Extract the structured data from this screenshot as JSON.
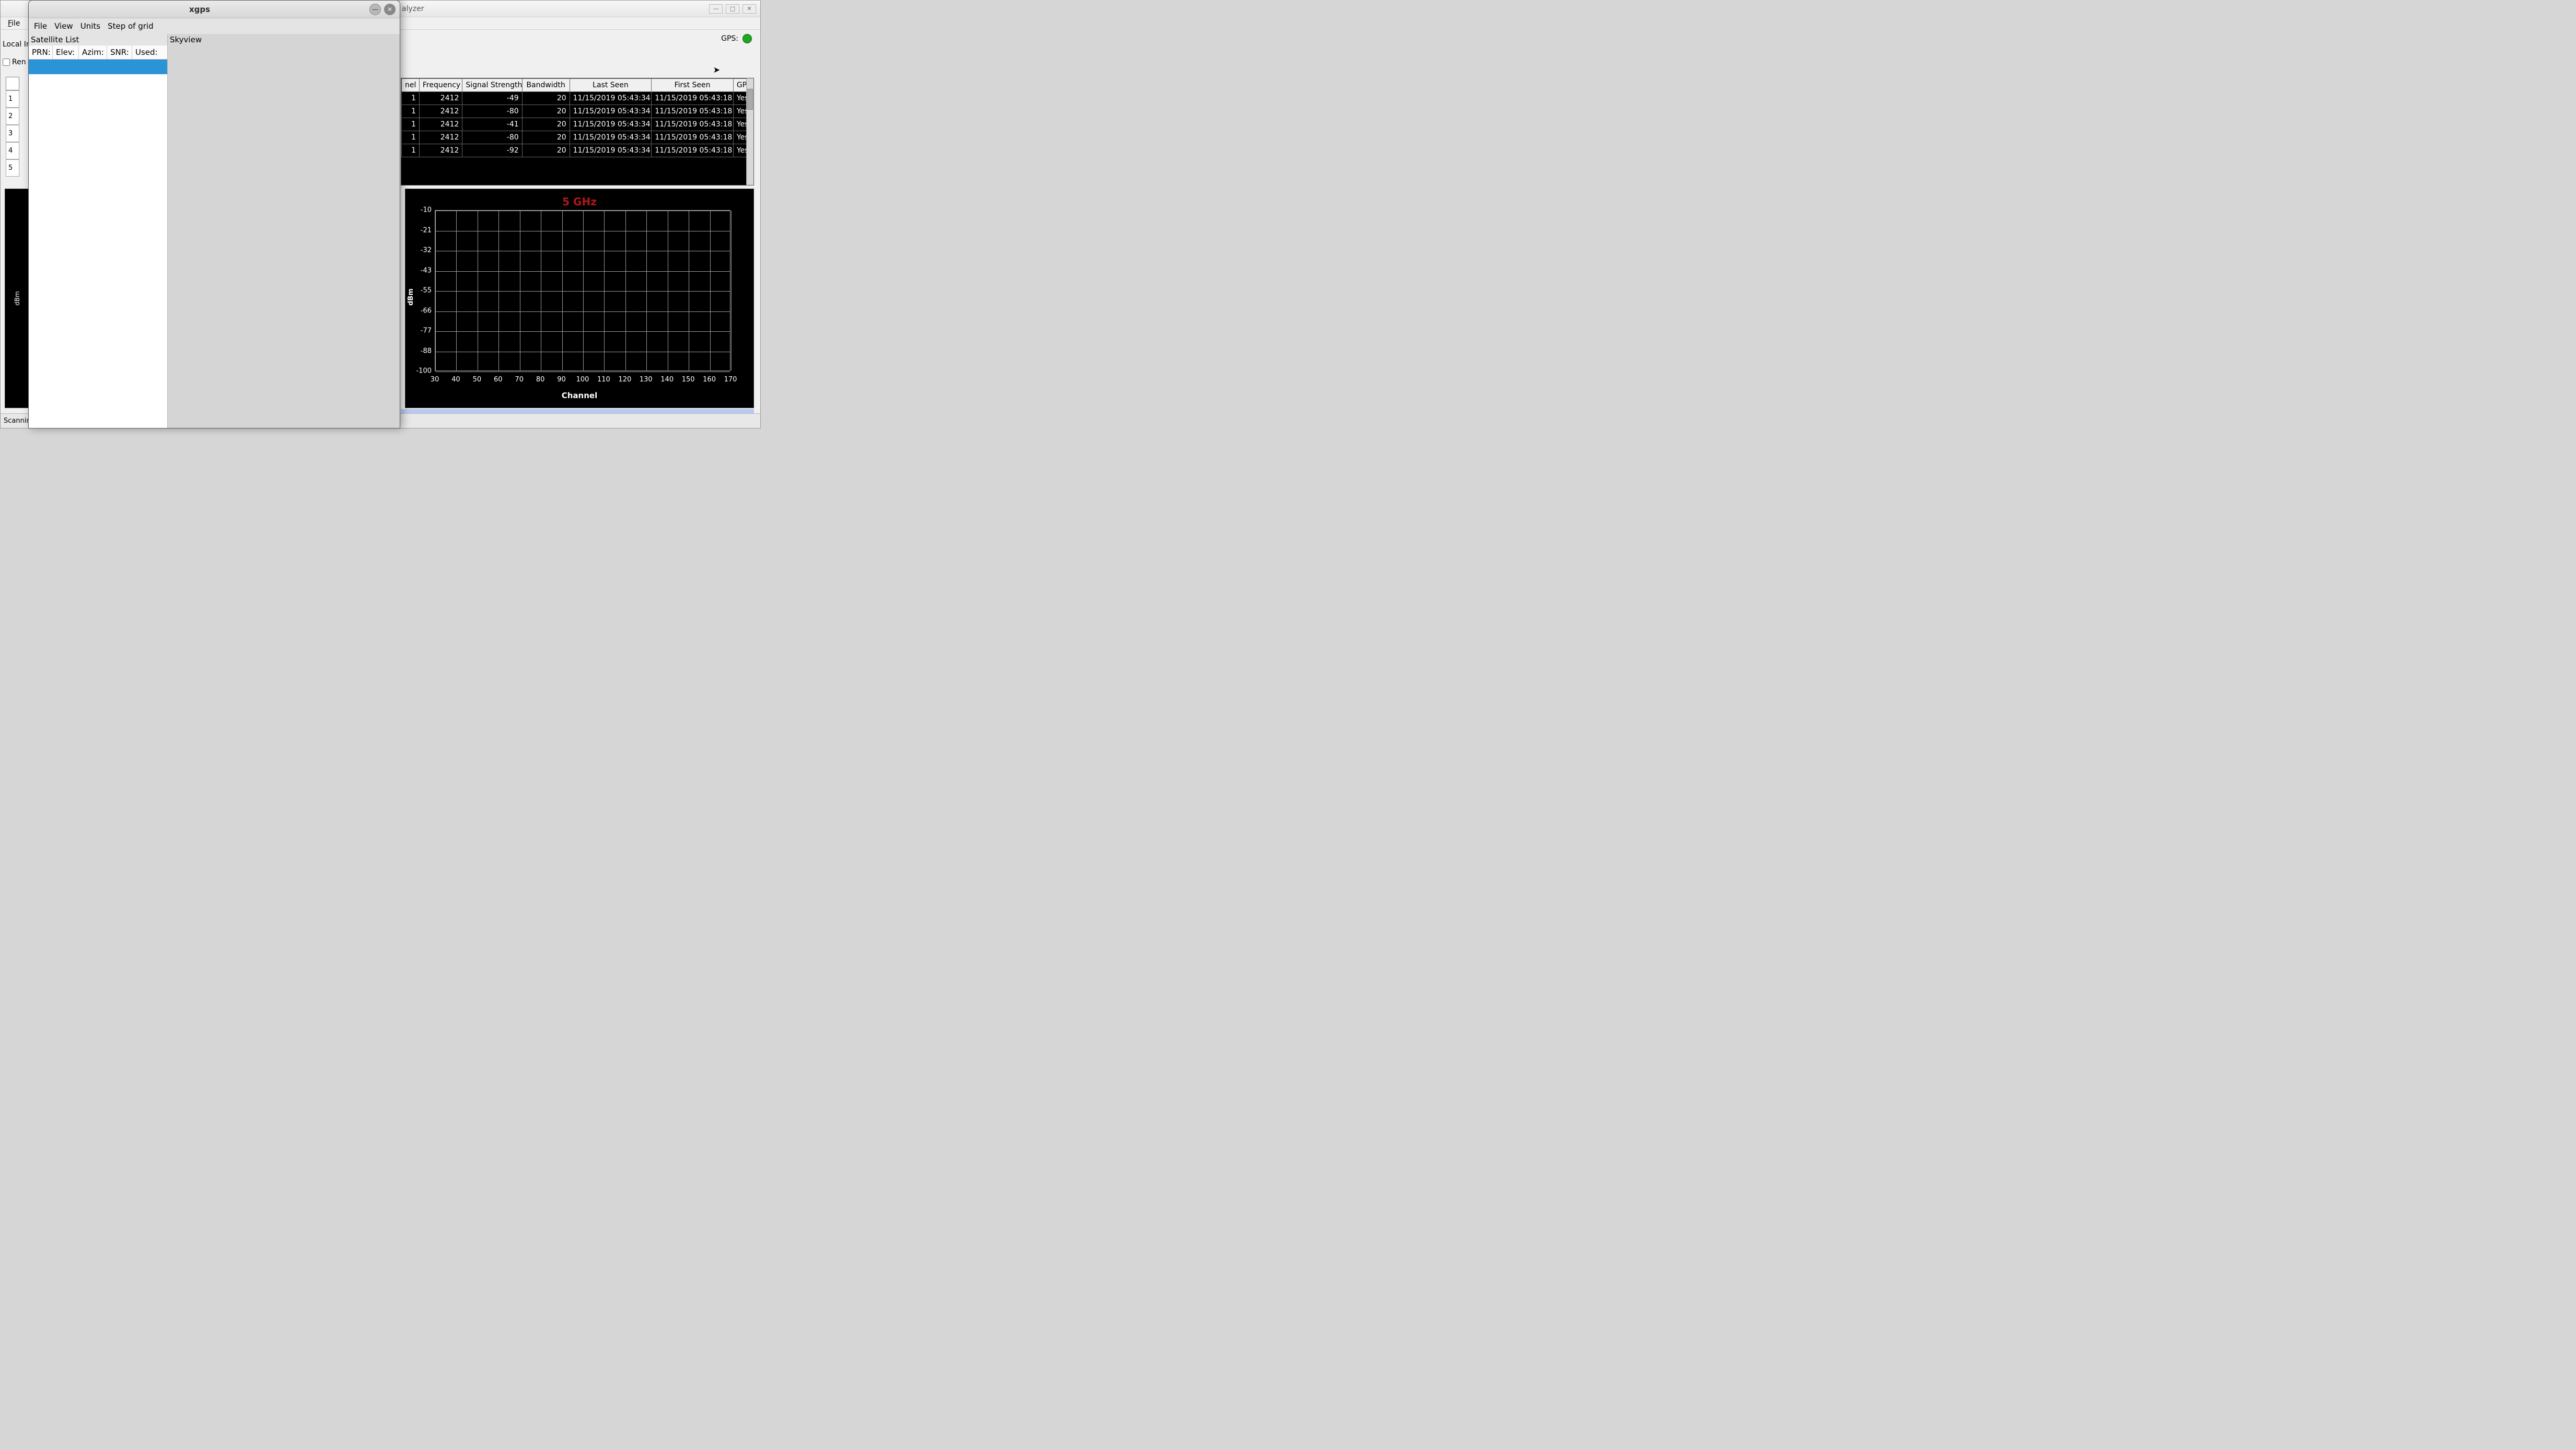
{
  "bg": {
    "title_fragment": "alyzer",
    "menubar": {
      "file": "File"
    },
    "local_label": "Local In",
    "checkbox_label": "Ren",
    "gps_label": "GPS:",
    "left_rows": [
      "1",
      "2",
      "3",
      "4",
      "5"
    ],
    "status": "Scannin"
  },
  "table": {
    "headers": [
      "nel",
      "Frequency",
      "Signal Strength",
      "Bandwidth",
      "Last Seen",
      "First Seen",
      "GPS"
    ],
    "rows": [
      {
        "nel": "1",
        "freq": "2412",
        "sig": "-49",
        "bw": "20",
        "last": "11/15/2019 05:43:34",
        "first": "11/15/2019 05:43:18",
        "gps": "Yes"
      },
      {
        "nel": "1",
        "freq": "2412",
        "sig": "-80",
        "bw": "20",
        "last": "11/15/2019 05:43:34",
        "first": "11/15/2019 05:43:18",
        "gps": "Yes"
      },
      {
        "nel": "1",
        "freq": "2412",
        "sig": "-41",
        "bw": "20",
        "last": "11/15/2019 05:43:34",
        "first": "11/15/2019 05:43:18",
        "gps": "Yes"
      },
      {
        "nel": "1",
        "freq": "2412",
        "sig": "-80",
        "bw": "20",
        "last": "11/15/2019 05:43:34",
        "first": "11/15/2019 05:43:18",
        "gps": "Yes"
      },
      {
        "nel": "1",
        "freq": "2412",
        "sig": "-92",
        "bw": "20",
        "last": "11/15/2019 05:43:34",
        "first": "11/15/2019 05:43:18",
        "gps": "Yes"
      }
    ]
  },
  "chart_data": {
    "type": "line",
    "title": "5 GHz",
    "xlabel": "Channel",
    "ylabel": "dBm",
    "x_ticks": [
      30,
      40,
      50,
      60,
      70,
      80,
      90,
      100,
      110,
      120,
      130,
      140,
      150,
      160,
      170
    ],
    "y_ticks": [
      -10,
      -21,
      -32,
      -43,
      -55,
      -66,
      -77,
      -88,
      -100
    ],
    "xlim": [
      30,
      170
    ],
    "ylim": [
      -100,
      -10
    ],
    "series": []
  },
  "left_chart": {
    "ylabel_fragment": "dBm"
  },
  "fg": {
    "title": "xgps",
    "menu": {
      "file": "File",
      "view": "View",
      "units": "Units",
      "step": "Step of grid"
    },
    "sat_header": "Satellite List",
    "sat_cols": {
      "prn": "PRN:",
      "elev": "Elev:",
      "azim": "Azim:",
      "snr": "SNR:",
      "used": "Used:"
    },
    "sky_header": "Skyview"
  }
}
